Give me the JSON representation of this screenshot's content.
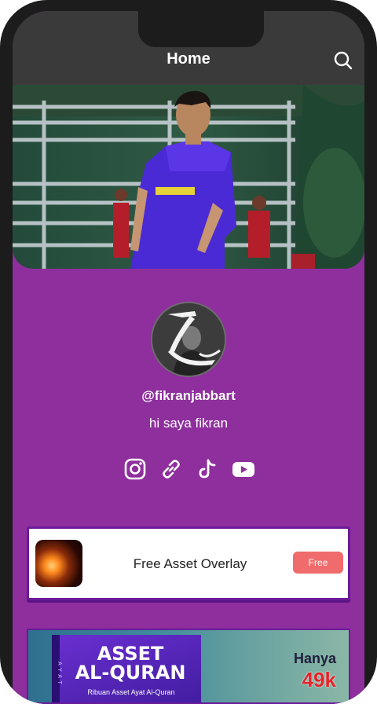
{
  "header": {
    "title": "Home",
    "search_icon": "search-icon"
  },
  "profile": {
    "username": "@fikranjabbart",
    "bio": "hi saya fikran"
  },
  "socials": [
    {
      "name": "instagram",
      "icon": "instagram-icon"
    },
    {
      "name": "link",
      "icon": "link-icon"
    },
    {
      "name": "tiktok",
      "icon": "tiktok-icon"
    },
    {
      "name": "youtube",
      "icon": "youtube-icon"
    }
  ],
  "link_card": {
    "title": "Free Asset Overlay",
    "button_label": "Free"
  },
  "banner": {
    "title_line1": "ASSET",
    "title_line2": "AL-QURAN",
    "subtitle": "Ribuan Asset Ayat Al-Quran",
    "side_text": "AYAT",
    "price_label": "Hanya",
    "price": "49k"
  },
  "colors": {
    "page_background": "#8e2f9d",
    "header_background": "#3a3a3a",
    "accent_button": "#f06b6b",
    "card_border": "#6a1b9a"
  }
}
